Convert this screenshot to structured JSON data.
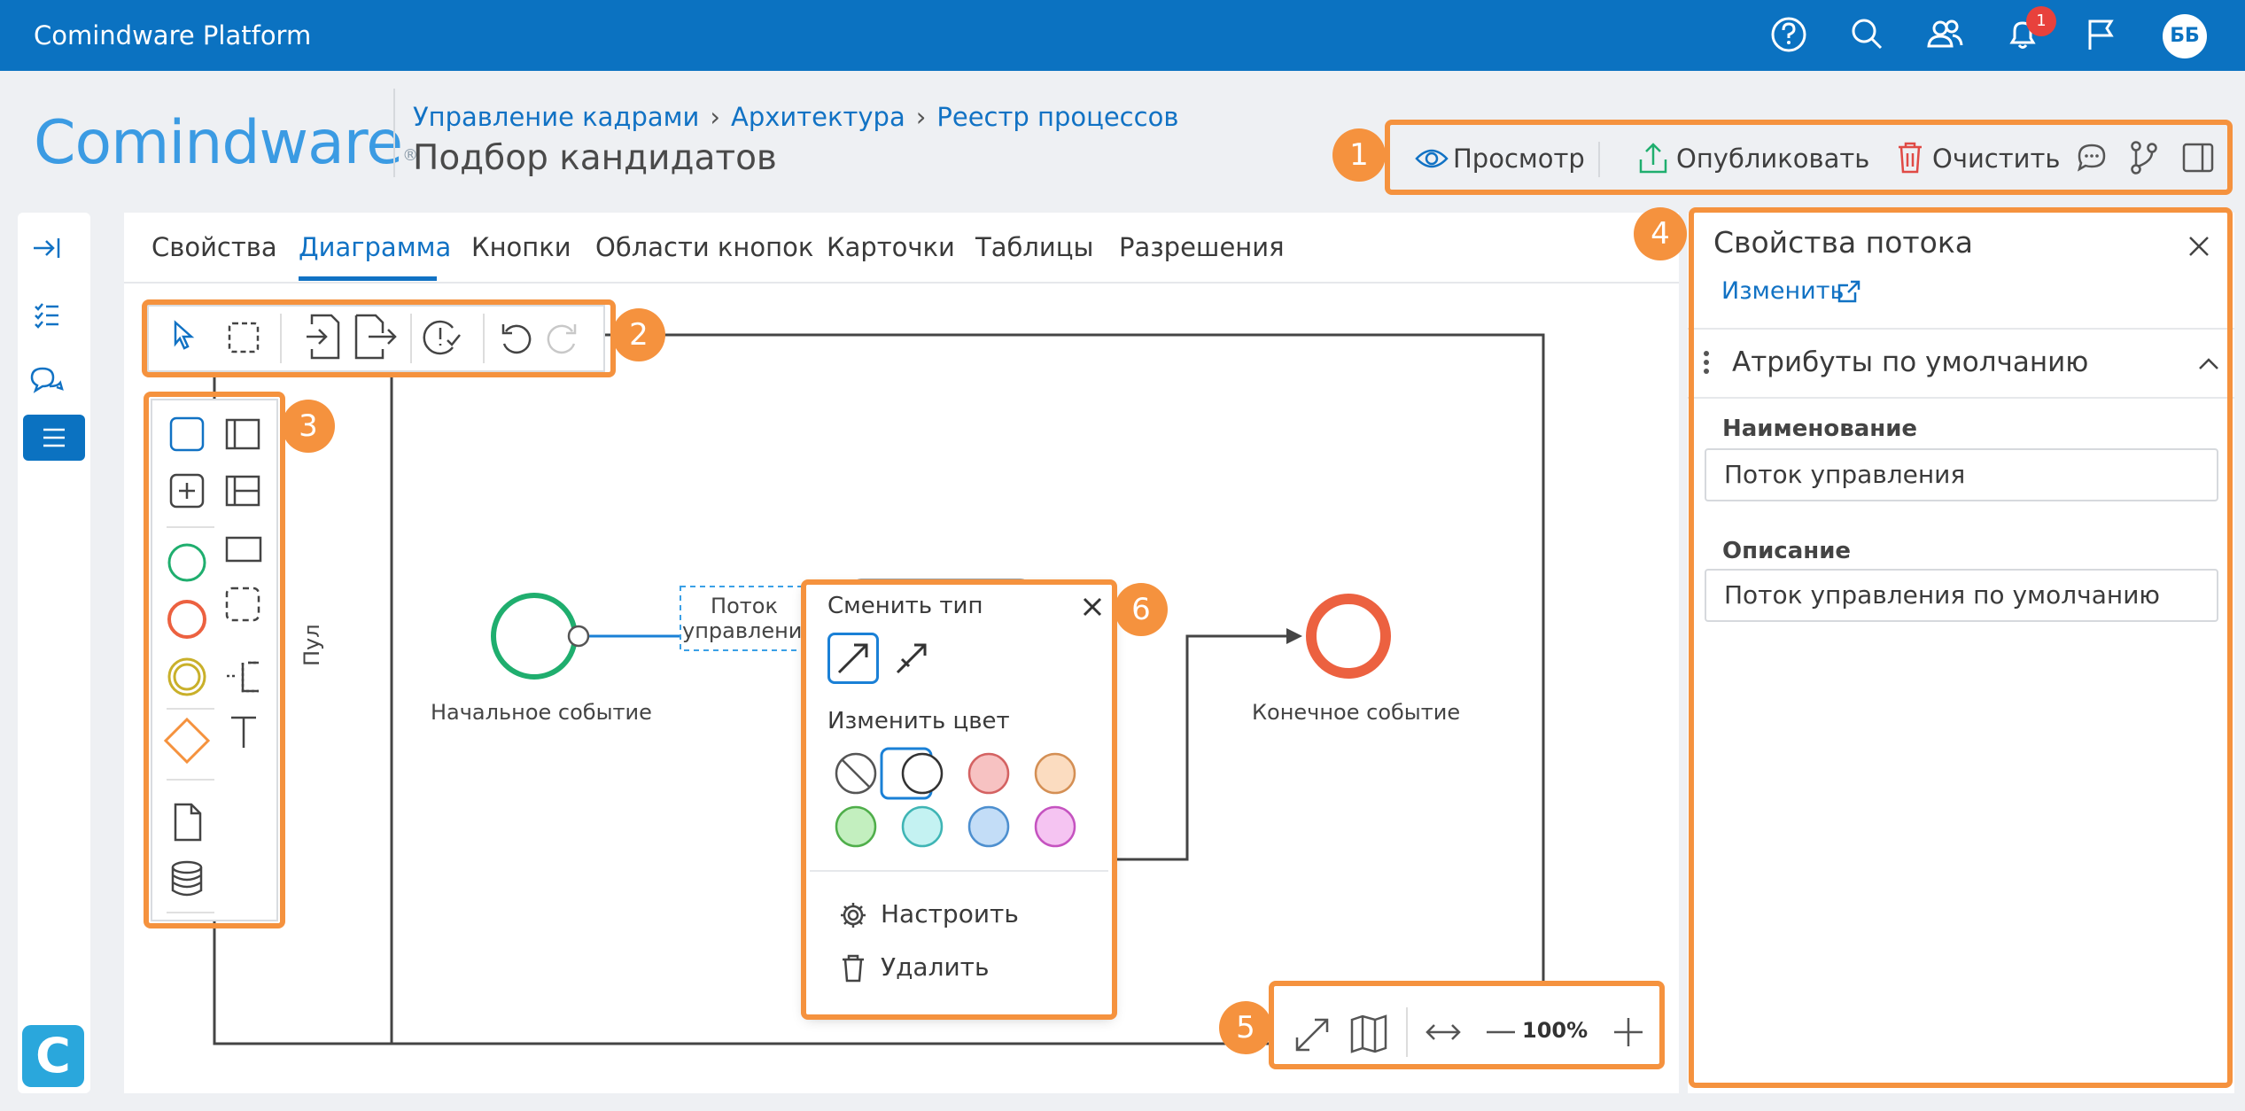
{
  "topbar": {
    "title": "Comindware Platform",
    "notification_count": "1",
    "avatar_initials": "ББ",
    "icons": [
      "help-icon",
      "search-icon",
      "users-icon",
      "bell-icon",
      "flag-icon"
    ]
  },
  "header": {
    "logo": "Comindware",
    "breadcrumbs": [
      "Управление кадрами",
      "Архитектура",
      "Реестр процессов"
    ],
    "page_title": "Подбор кандидатов",
    "actions": {
      "preview": "Просмотр",
      "publish": "Опубликовать",
      "clear": "Очистить"
    }
  },
  "tabs": [
    "Свойства",
    "Диаграмма",
    "Кнопки",
    "Области кнопок",
    "Карточки",
    "Таблицы",
    "Разрешения"
  ],
  "active_tab": "Диаграмма",
  "callouts": [
    "1",
    "2",
    "3",
    "4",
    "5",
    "6"
  ],
  "diagram": {
    "pool_label": "Пул",
    "start_event": "Начальное событие",
    "end_event": "Конечное событие",
    "flow_label_line1": "Поток",
    "flow_label_line2": "управления"
  },
  "popup": {
    "change_type": "Сменить тип",
    "change_color": "Изменить цвет",
    "configure": "Настроить",
    "delete": "Удалить",
    "colors": [
      "none",
      "#ffffff",
      "#f7c2c2",
      "#fbdcc0",
      "#fbf7bd",
      "#c3efbf",
      "#c4f2f2",
      "#c3ddf7",
      "#f5c4f2",
      "#c8c8c8"
    ]
  },
  "zoom": {
    "level": "100%"
  },
  "panel": {
    "title": "Свойства потока",
    "edit_link": "Изменить",
    "section": "Атрибуты по умолчанию",
    "name_label": "Наименование",
    "name_value": "Поток управления",
    "desc_label": "Описание",
    "desc_value": "Поток управления по умолчанию"
  },
  "colors": {
    "brand_blue": "#0b72c1",
    "callout_orange": "#f5923e",
    "start_green": "#1fae6e",
    "end_red": "#ec6140"
  }
}
